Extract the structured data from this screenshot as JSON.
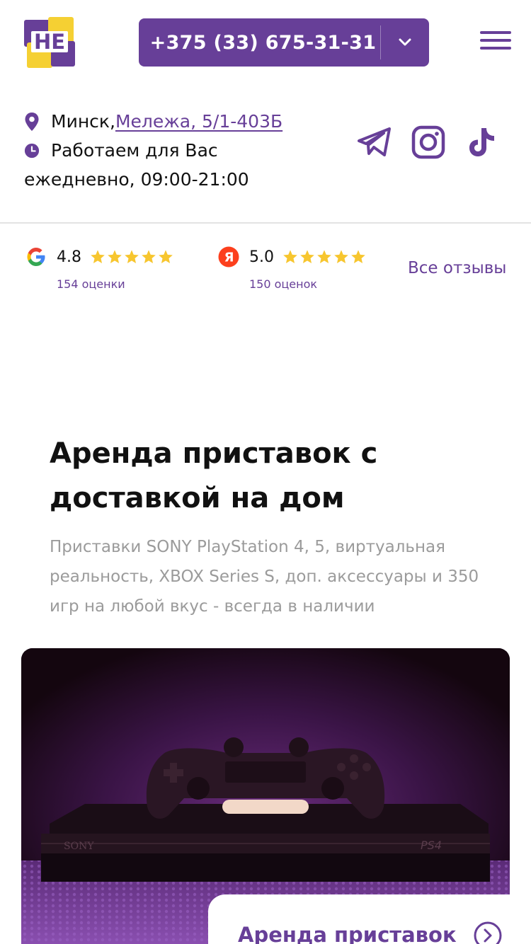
{
  "brand": {
    "logo_text": "НЕ",
    "accent_color": "#673f98",
    "yellow_color": "#f5d033"
  },
  "header": {
    "phone": "+375 (33) 675-31-31",
    "phone_dropdown_icon": "chevron-down-icon",
    "menu_icon": "hamburger-menu-icon"
  },
  "contacts": {
    "city": "Минск, ",
    "address": "Мележа, 5/1-403Б",
    "hours_line1": "Работаем для Вас",
    "hours_line2": "ежедневно, 09:00-21:00",
    "socials": [
      "telegram-icon",
      "instagram-icon",
      "tiktok-icon"
    ]
  },
  "ratings": {
    "google": {
      "score": "4.8",
      "count": "154 оценки",
      "stars": 5
    },
    "yandex": {
      "score": "5.0",
      "count": "150 оценок",
      "stars": 5
    },
    "all_reviews": "Все отзывы"
  },
  "hero": {
    "title": "Аренда приставок с доставкой на дом",
    "subtitle": "Приставки SONY PlayStation 4, 5, виртуальная реальность, XBOX Series S, доп. аксессуары и 350 игр на любой вкус - всегда в наличии",
    "console_brand": "SONY",
    "console_model": "PS4",
    "cta": "Аренда приставок"
  }
}
